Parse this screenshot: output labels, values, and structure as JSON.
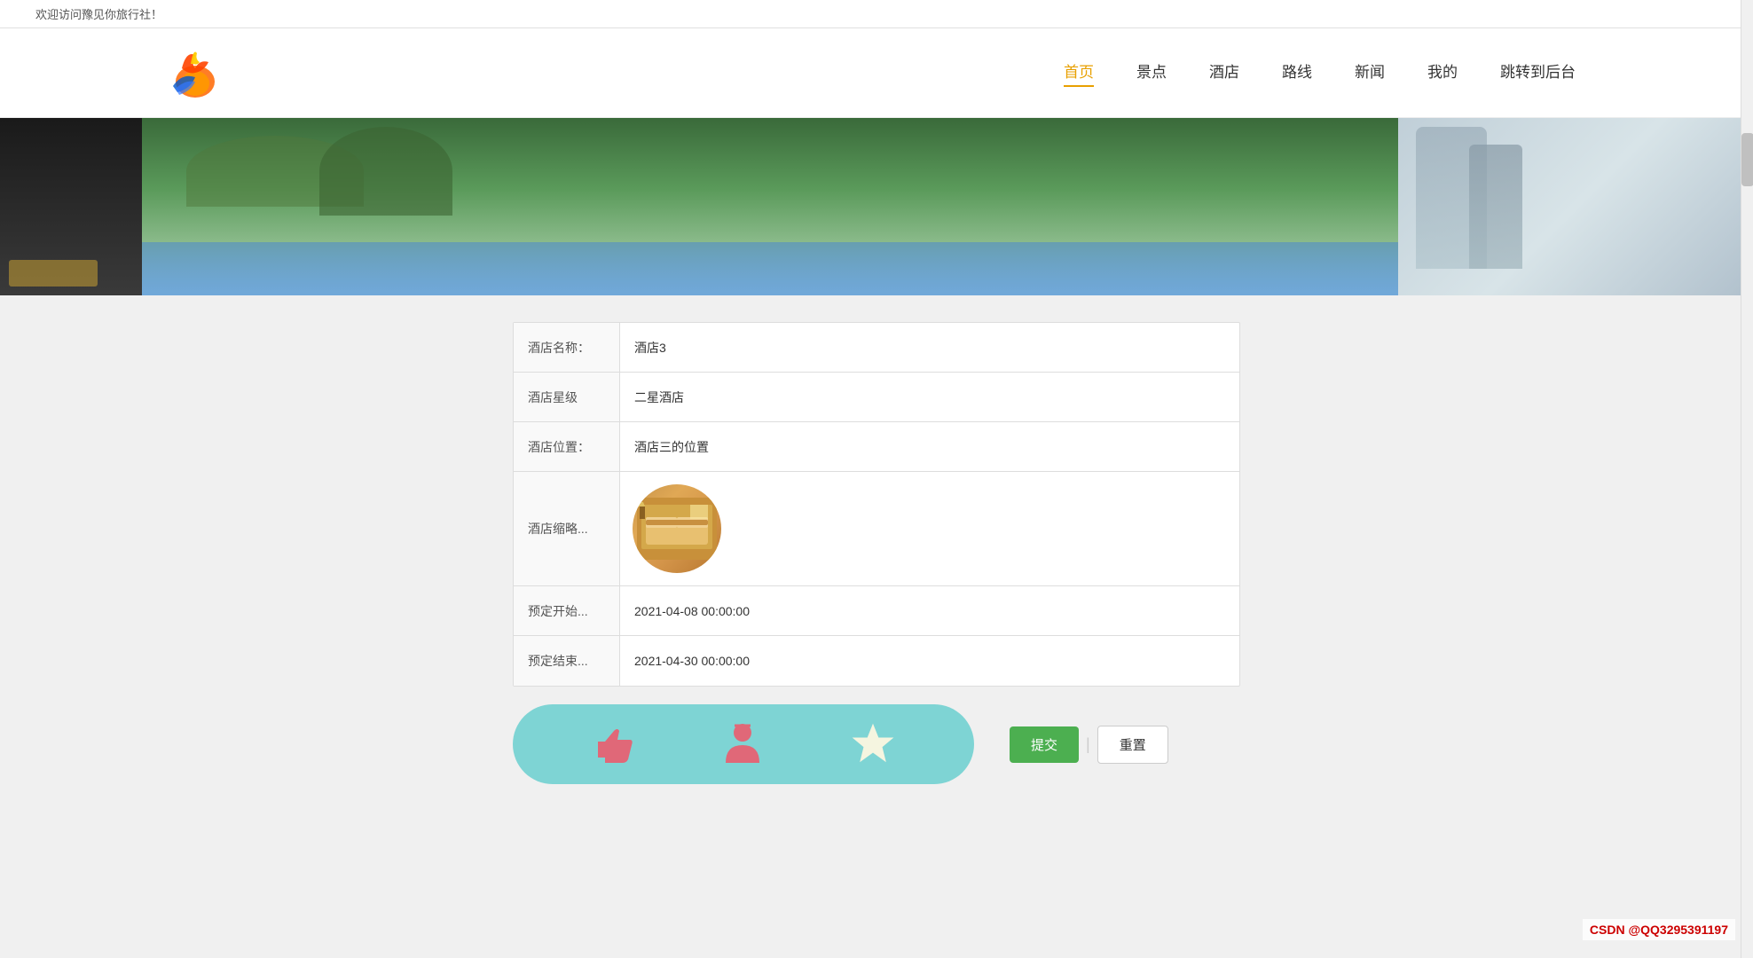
{
  "topbar": {
    "welcome_text": "欢迎访问豫见你旅行社！"
  },
  "nav": {
    "items": [
      {
        "label": "首页",
        "active": true
      },
      {
        "label": "景点",
        "active": false
      },
      {
        "label": "酒店",
        "active": false
      },
      {
        "label": "路线",
        "active": false
      },
      {
        "label": "新闻",
        "active": false
      },
      {
        "label": "我的",
        "active": false
      },
      {
        "label": "跳转到后台",
        "active": false
      }
    ]
  },
  "form": {
    "rows": [
      {
        "label": "酒店名称：",
        "value": "酒店3"
      },
      {
        "label": "酒店星级",
        "value": "二星酒店"
      },
      {
        "label": "酒店位置：",
        "value": "酒店三的位置"
      },
      {
        "label": "酒店缩略...",
        "value": ""
      },
      {
        "label": "预定开始...",
        "value": "2021-04-08 00:00:00"
      },
      {
        "label": "预定结束...",
        "value": "2021-04-30 00:00:00"
      }
    ]
  },
  "buttons": {
    "submit_label": "提交",
    "reset_label": "重置"
  },
  "watermark": {
    "text": "CSDN @QQ3295391197"
  }
}
